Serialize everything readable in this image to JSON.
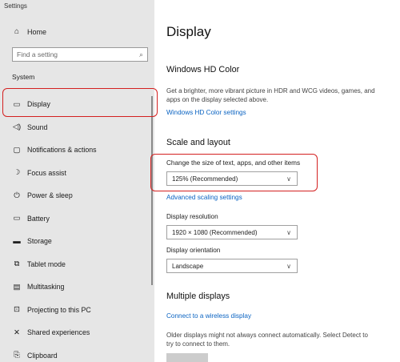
{
  "app": {
    "title": "Settings"
  },
  "sidebar": {
    "home_label": "Home",
    "search_placeholder": "Find a setting",
    "section_label": "System",
    "items": [
      {
        "label": "Display",
        "icon": "monitor-icon"
      },
      {
        "label": "Sound",
        "icon": "speaker-icon"
      },
      {
        "label": "Notifications & actions",
        "icon": "notification-icon"
      },
      {
        "label": "Focus assist",
        "icon": "moon-icon"
      },
      {
        "label": "Power & sleep",
        "icon": "power-icon"
      },
      {
        "label": "Battery",
        "icon": "battery-icon"
      },
      {
        "label": "Storage",
        "icon": "storage-icon"
      },
      {
        "label": "Tablet mode",
        "icon": "tablet-icon"
      },
      {
        "label": "Multitasking",
        "icon": "multitasking-icon"
      },
      {
        "label": "Projecting to this PC",
        "icon": "project-icon"
      },
      {
        "label": "Shared experiences",
        "icon": "shared-icon"
      },
      {
        "label": "Clipboard",
        "icon": "clipboard-icon"
      }
    ]
  },
  "main": {
    "title": "Display",
    "hdr": {
      "heading": "Windows HD Color",
      "description": "Get a brighter, more vibrant picture in HDR and WCG videos, games, and apps on the display selected above.",
      "link": "Windows HD Color settings"
    },
    "scale": {
      "heading": "Scale and layout",
      "size_label": "Change the size of text, apps, and other items",
      "size_value": "125% (Recommended)",
      "advanced_link": "Advanced scaling settings",
      "resolution_label": "Display resolution",
      "resolution_value": "1920 × 1080 (Recommended)",
      "orientation_label": "Display orientation",
      "orientation_value": "Landscape"
    },
    "multiple": {
      "heading": "Multiple displays",
      "link": "Connect to a wireless display",
      "description": "Older displays might not always connect automatically. Select Detect to try to connect to them."
    }
  },
  "colors": {
    "sidebar_bg": "#e6e6e6",
    "link": "#0a63c2",
    "highlight": "#d42020"
  }
}
